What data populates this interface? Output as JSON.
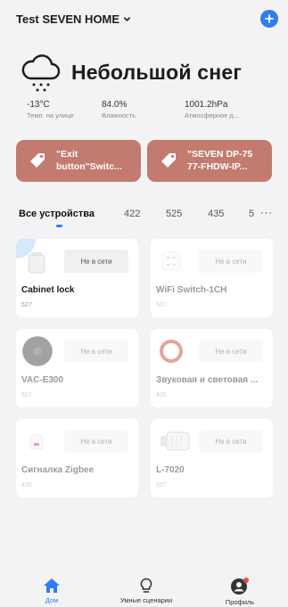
{
  "header": {
    "home_name": "Test SEVEN HOME"
  },
  "weather": {
    "condition": "Небольшой снег",
    "stats": [
      {
        "value": "-13°C",
        "label": "Темп. на улице"
      },
      {
        "value": "84.0%",
        "label": "Влажность"
      },
      {
        "value": "1001.2hPa",
        "label": "Атмосферное д..."
      }
    ]
  },
  "scenes": [
    {
      "label": "\"Exit\nbutton\"Switc..."
    },
    {
      "label": "\"SEVEN DP-75\n77-FHDW-IP..."
    }
  ],
  "tabs": [
    "Все устройства",
    "422",
    "525",
    "435",
    "5"
  ],
  "more": "···",
  "devices": [
    {
      "name": "Cabinet lock",
      "room": "527",
      "status": "Не в сети",
      "online": true
    },
    {
      "name": "WiFi Switch-1CH",
      "room": "527",
      "status": "Не в сети",
      "online": false
    },
    {
      "name": "VAC-E300",
      "room": "527",
      "status": "Не в сети",
      "online": false
    },
    {
      "name": "Звуковая и световая ...",
      "room": "435",
      "status": "Не в сети",
      "online": false
    },
    {
      "name": "Сигналка Zigbee",
      "room": "435",
      "status": "Не в сети",
      "online": false
    },
    {
      "name": "L-7020",
      "room": "527",
      "status": "Не в сети",
      "online": false
    }
  ],
  "nav": [
    {
      "label": "Дом"
    },
    {
      "label": "Умные сценарии"
    },
    {
      "label": "Профиль"
    }
  ],
  "colors": {
    "accent": "#2f7cf6",
    "scene_bg": "#c37b6f",
    "badge": "#e74c3c"
  }
}
